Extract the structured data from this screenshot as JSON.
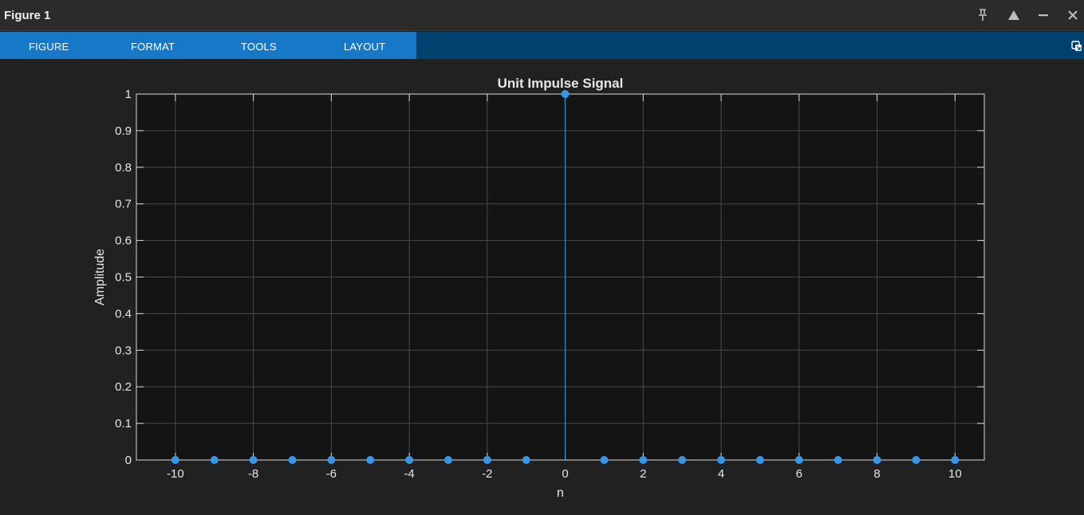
{
  "window": {
    "title": "Figure 1"
  },
  "toolstrip": {
    "tabs": [
      {
        "label": "FIGURE"
      },
      {
        "label": "FORMAT"
      },
      {
        "label": "TOOLS"
      },
      {
        "label": "LAYOUT"
      }
    ]
  },
  "icons": {
    "pin": "pin-icon",
    "maximize": "maximize-icon",
    "minimize": "minimize-icon",
    "close": "close-icon",
    "undock": "undock-icon"
  },
  "colors": {
    "accent_tab": "#1778c7",
    "toolstrip_bg": "#00416f",
    "stem": "#3796e8",
    "axes_bg": "#141414"
  },
  "chart_data": {
    "type": "scatter",
    "style": "stem",
    "title": "Unit Impulse Signal",
    "xlabel": "n",
    "ylabel": "Amplitude",
    "xlim": [
      -11,
      10.75
    ],
    "ylim": [
      0,
      1
    ],
    "grid": true,
    "xticks": [
      -10,
      -8,
      -6,
      -4,
      -2,
      0,
      2,
      4,
      6,
      8,
      10
    ],
    "yticks": [
      0,
      0.1,
      0.2,
      0.3,
      0.4,
      0.5,
      0.6,
      0.7,
      0.8,
      0.9,
      1
    ],
    "series": [
      {
        "x": [
          -10,
          -9,
          -8,
          -7,
          -6,
          -5,
          -4,
          -3,
          -2,
          -1,
          0,
          1,
          2,
          3,
          4,
          5,
          6,
          7,
          8,
          9,
          10
        ],
        "y": [
          0,
          0,
          0,
          0,
          0,
          0,
          0,
          0,
          0,
          0,
          1,
          0,
          0,
          0,
          0,
          0,
          0,
          0,
          0,
          0,
          0
        ]
      }
    ]
  }
}
